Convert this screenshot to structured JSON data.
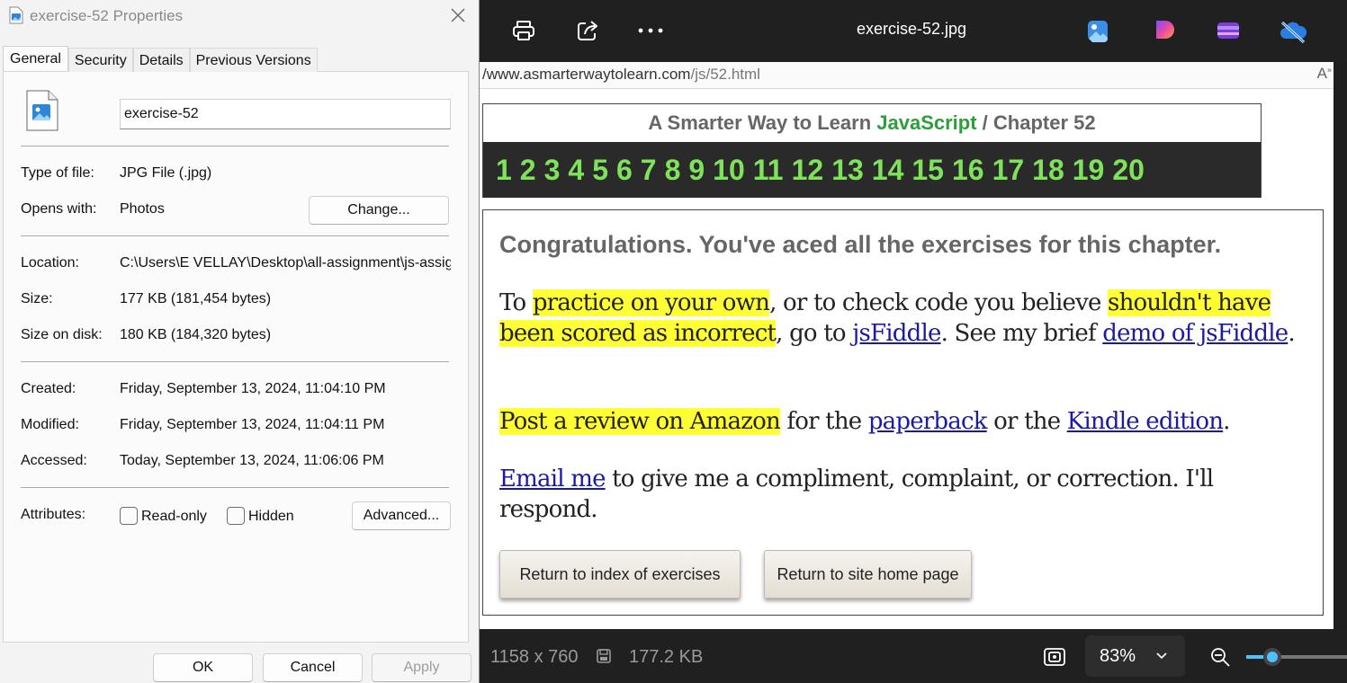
{
  "dialog": {
    "title": "exercise-52 Properties",
    "tabs": [
      "General",
      "Security",
      "Details",
      "Previous Versions"
    ],
    "file_name_value": "exercise-52",
    "type_label": "Type of file:",
    "type_value": "JPG File (.jpg)",
    "opens_label": "Opens with:",
    "opens_value": "Photos",
    "change_button": "Change...",
    "location_label": "Location:",
    "location_value": "C:\\Users\\E VELLAY\\Desktop\\all-assignment\\js-assig",
    "size_label": "Size:",
    "size_value": "177 KB (181,454 bytes)",
    "size_disk_label": "Size on disk:",
    "size_disk_value": "180 KB (184,320 bytes)",
    "created_label": "Created:",
    "created_value": "Friday, September 13, 2024, 11:04:10 PM",
    "modified_label": "Modified:",
    "modified_value": "Friday, September 13, 2024, 11:04:11 PM",
    "accessed_label": "Accessed:",
    "accessed_value": "Today, September 13, 2024, 11:06:06 PM",
    "attributes_label": "Attributes:",
    "readonly_label": "Read-only",
    "hidden_label": "Hidden",
    "readonly_checked": false,
    "hidden_checked": false,
    "advanced_button": "Advanced...",
    "ok_button": "OK",
    "cancel_button": "Cancel",
    "apply_button": "Apply"
  },
  "viewer": {
    "title": "exercise-52.jpg",
    "toolbar_icons": [
      "print-icon",
      "share-icon",
      "more-icon"
    ],
    "app_icons": [
      "photos-edit-icon",
      "designer-icon",
      "clipchamp-icon",
      "onedrive-offline-icon"
    ],
    "dimensions": "1158 x 760",
    "file_size": "177.2 KB",
    "zoom_value": "83%",
    "zoom_level_fraction": 0.26
  },
  "page": {
    "url_prefix": "/www.asmarterwaytolearn.com",
    "url_suffix": "/js/52.html",
    "header_prefix": "A Smarter Way to Learn ",
    "header_js": "JavaScript",
    "header_suffix": "  /  Chapter 52",
    "chapters": [
      "1",
      "2",
      "3",
      "4",
      "5",
      "6",
      "7",
      "8",
      "9",
      "10",
      "11",
      "12",
      "13",
      "14",
      "15",
      "16",
      "17",
      "18",
      "19",
      "20"
    ],
    "congrats": "Congratulations. You've aced all the exercises for this chapter.",
    "p1_a": "To ",
    "p1_hl1": "practice on your own",
    "p1_b": ", or to check code you believe ",
    "p1_hl2": "shouldn't have been scored as incorrect",
    "p1_c": ", go to ",
    "p1_link1": "jsFiddle",
    "p1_d": ". See my brief ",
    "p1_link2": "demo of jsFiddle",
    "p1_e": ".",
    "p2_hl": "Post a review on Amazon",
    "p2_a": " for the ",
    "p2_link1": "paperback",
    "p2_b": " or the ",
    "p2_link2": "Kindle edition",
    "p2_c": ".",
    "p3_link": "Email me",
    "p3_a": " to give me a compliment, complaint, or correction. I'll respond.",
    "btn_index": "Return to index of exercises",
    "btn_home": "Return to site home page"
  },
  "colors": {
    "highlight": "#ffff33",
    "link": "#1a1aa6",
    "chapter_green": "#7ee25b",
    "javascript_green": "#2e9e3a",
    "zoom_accent": "#4cc2ff"
  }
}
